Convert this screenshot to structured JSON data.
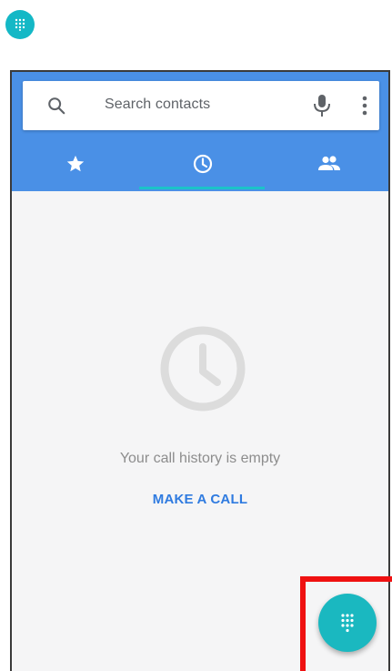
{
  "search": {
    "placeholder": "Search contacts"
  },
  "tabs": [
    {
      "name": "favorites",
      "icon": "star-icon",
      "selected": false
    },
    {
      "name": "recents",
      "icon": "clock-icon",
      "selected": true
    },
    {
      "name": "contacts",
      "icon": "people-icon",
      "selected": false
    }
  ],
  "empty_state": {
    "message": "Your call history is empty",
    "action_label": "MAKE A CALL",
    "icon": "clock-icon"
  },
  "fab": {
    "icon": "dialpad-icon"
  },
  "colors": {
    "header": "#4a90e6",
    "accent_teal": "#1ab8c0",
    "action_blue": "#2f7be0",
    "highlight_red": "#ef1111"
  }
}
